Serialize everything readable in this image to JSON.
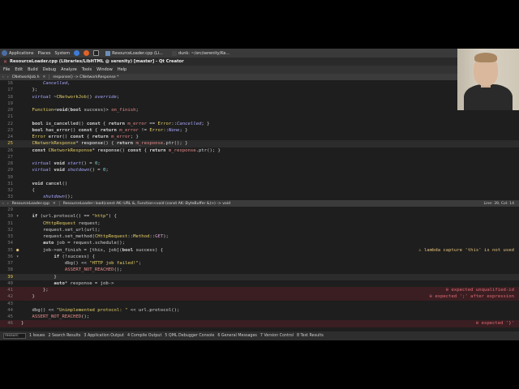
{
  "panel": {
    "applications": "Applications",
    "places": "Places",
    "system": "System",
    "task1": "ResourceLoader.cpp (Li...",
    "task2": "dunk: ~/src/serenity/Ke..."
  },
  "window": {
    "title": "ResourceLoader.cpp (Libraries/LibHTML @ serenity) [master] - Qt Creator"
  },
  "menu": [
    "File",
    "Edit",
    "Build",
    "Debug",
    "Analyze",
    "Tools",
    "Window",
    "Help"
  ],
  "top_editor": {
    "file": "CNetworkJob.h",
    "symbol": "response() -> CNetworkResponse *"
  },
  "top_code": [
    {
      "n": "16",
      "spans": [
        {
          "c": "it",
          "t": "        Cancelled,"
        }
      ]
    },
    {
      "n": "17",
      "spans": [
        {
          "c": "",
          "t": "    };"
        }
      ]
    },
    {
      "n": "18",
      "spans": [
        {
          "c": "it",
          "t": "    virtual"
        },
        {
          "c": "",
          "t": " ~"
        },
        {
          "c": "t",
          "t": "CNetworkJob"
        },
        {
          "c": "",
          "t": "() "
        },
        {
          "c": "it",
          "t": "override"
        },
        {
          "c": "",
          "t": ";"
        }
      ]
    },
    {
      "n": "19",
      "spans": []
    },
    {
      "n": "20",
      "spans": [
        {
          "c": "t",
          "t": "    Function"
        },
        {
          "c": "",
          "t": "<"
        },
        {
          "c": "k",
          "t": "void"
        },
        {
          "c": "",
          "t": "("
        },
        {
          "c": "k",
          "t": "bool"
        },
        {
          "c": "",
          "t": " success)> "
        },
        {
          "c": "v",
          "t": "on_finish"
        },
        {
          "c": "",
          "t": ";"
        }
      ]
    },
    {
      "n": "21",
      "spans": []
    },
    {
      "n": "22",
      "spans": [
        {
          "c": "k",
          "t": "    bool"
        },
        {
          "c": "f",
          "t": " is_cancelled"
        },
        {
          "c": "",
          "t": "() "
        },
        {
          "c": "k",
          "t": "const"
        },
        {
          "c": "",
          "t": " { "
        },
        {
          "c": "k",
          "t": "return"
        },
        {
          "c": "v",
          "t": " m_error"
        },
        {
          "c": "",
          "t": " == "
        },
        {
          "c": "t",
          "t": "Error"
        },
        {
          "c": "",
          "t": "::"
        },
        {
          "c": "it",
          "t": "Cancelled"
        },
        {
          "c": "",
          "t": "; }"
        }
      ]
    },
    {
      "n": "23",
      "spans": [
        {
          "c": "k",
          "t": "    bool"
        },
        {
          "c": "f",
          "t": " has_error"
        },
        {
          "c": "",
          "t": "() "
        },
        {
          "c": "k",
          "t": "const"
        },
        {
          "c": "",
          "t": " { "
        },
        {
          "c": "k",
          "t": "return"
        },
        {
          "c": "v",
          "t": " m_error"
        },
        {
          "c": "",
          "t": " != "
        },
        {
          "c": "t",
          "t": "Error"
        },
        {
          "c": "",
          "t": "::"
        },
        {
          "c": "it",
          "t": "None"
        },
        {
          "c": "",
          "t": "; }"
        }
      ]
    },
    {
      "n": "24",
      "spans": [
        {
          "c": "t",
          "t": "    Error"
        },
        {
          "c": "f",
          "t": " error"
        },
        {
          "c": "",
          "t": "() "
        },
        {
          "c": "k",
          "t": "const"
        },
        {
          "c": "",
          "t": " { "
        },
        {
          "c": "k",
          "t": "return"
        },
        {
          "c": "v",
          "t": " m_error"
        },
        {
          "c": "",
          "t": "; }"
        }
      ]
    },
    {
      "n": "25",
      "cur": true,
      "spans": [
        {
          "c": "t",
          "t": "    CNetworkResponse"
        },
        {
          "c": "",
          "t": "* "
        },
        {
          "c": "f",
          "t": "response"
        },
        {
          "c": "",
          "t": "() { "
        },
        {
          "c": "k",
          "t": "return"
        },
        {
          "c": "v",
          "t": " m_response"
        },
        {
          "c": "",
          "t": ".ptr(); }"
        }
      ]
    },
    {
      "n": "26",
      "spans": [
        {
          "c": "k",
          "t": "    const"
        },
        {
          "c": "t",
          "t": " CNetworkResponse"
        },
        {
          "c": "",
          "t": "* "
        },
        {
          "c": "f",
          "t": "response"
        },
        {
          "c": "",
          "t": "() "
        },
        {
          "c": "k",
          "t": "const"
        },
        {
          "c": "",
          "t": " { "
        },
        {
          "c": "k",
          "t": "return"
        },
        {
          "c": "v",
          "t": " m_response"
        },
        {
          "c": "",
          "t": ".ptr(); }"
        }
      ]
    },
    {
      "n": "27",
      "spans": []
    },
    {
      "n": "28",
      "spans": [
        {
          "c": "it",
          "t": "    virtual"
        },
        {
          "c": "k",
          "t": " void"
        },
        {
          "c": "it",
          "t": " start"
        },
        {
          "c": "",
          "t": "() = "
        },
        {
          "c": "n",
          "t": "0"
        },
        {
          "c": "",
          "t": ";"
        }
      ]
    },
    {
      "n": "29",
      "spans": [
        {
          "c": "it",
          "t": "    virtual"
        },
        {
          "c": "k",
          "t": " void"
        },
        {
          "c": "it",
          "t": " shutdown"
        },
        {
          "c": "",
          "t": "() = "
        },
        {
          "c": "n",
          "t": "0"
        },
        {
          "c": "",
          "t": ";"
        }
      ]
    },
    {
      "n": "30",
      "spans": []
    },
    {
      "n": "31",
      "spans": [
        {
          "c": "k",
          "t": "    void"
        },
        {
          "c": "f",
          "t": " cancel"
        },
        {
          "c": "",
          "t": "()"
        }
      ]
    },
    {
      "n": "32",
      "spans": [
        {
          "c": "",
          "t": "    {"
        }
      ]
    },
    {
      "n": "33",
      "spans": [
        {
          "c": "it",
          "t": "        shutdown"
        },
        {
          "c": "",
          "t": "();"
        }
      ]
    }
  ],
  "bottom_editor": {
    "file": "ResourceLoader.cpp",
    "symbol": "ResourceLoader::load(const AK::URL &, Function<void (const AK::ByteBuffer &)>) -> void",
    "position": "Line: 39, Col: 14"
  },
  "bottom_code": [
    {
      "n": "29",
      "spans": []
    },
    {
      "n": "30",
      "fold": "▾",
      "spans": [
        {
          "c": "k",
          "t": "    if"
        },
        {
          "c": "",
          "t": " (url.protocol() == "
        },
        {
          "c": "s",
          "t": "\"http\""
        },
        {
          "c": "",
          "t": ") {"
        }
      ]
    },
    {
      "n": "31",
      "spans": [
        {
          "c": "t",
          "t": "        CHttpRequest"
        },
        {
          "c": "",
          "t": " request;"
        }
      ]
    },
    {
      "n": "32",
      "spans": [
        {
          "c": "",
          "t": "        request.set_url(url);"
        }
      ]
    },
    {
      "n": "33",
      "spans": [
        {
          "c": "",
          "t": "        request.set_method("
        },
        {
          "c": "t",
          "t": "CHttpRequest"
        },
        {
          "c": "",
          "t": "::"
        },
        {
          "c": "t",
          "t": "Method"
        },
        {
          "c": "",
          "t": "::"
        },
        {
          "c": "mg",
          "t": "GET"
        },
        {
          "c": "",
          "t": ");"
        }
      ]
    },
    {
      "n": "34",
      "spans": [
        {
          "c": "k",
          "t": "        auto"
        },
        {
          "c": "",
          "t": " job = request.schedule();"
        }
      ]
    },
    {
      "n": "35",
      "warn": true,
      "fold": "▾",
      "spans": [
        {
          "c": "",
          "t": "        job->on_finish = [this, job]("
        },
        {
          "c": "k",
          "t": "bool"
        },
        {
          "c": "",
          "t": " success) {"
        }
      ],
      "diag": "⚠ lambda capture 'this' is not used"
    },
    {
      "n": "36",
      "fold": "▾",
      "spans": [
        {
          "c": "k",
          "t": "            if"
        },
        {
          "c": "",
          "t": " (!success) {"
        }
      ]
    },
    {
      "n": "37",
      "spans": [
        {
          "c": "",
          "t": "                dbg() << "
        },
        {
          "c": "s",
          "t": "\"HTTP job failed!\""
        },
        {
          "c": "",
          "t": ";"
        }
      ]
    },
    {
      "n": "38",
      "spans": [
        {
          "c": "v",
          "t": "                ASSERT_NOT_REACHED"
        },
        {
          "c": "",
          "t": "();"
        }
      ]
    },
    {
      "n": "39",
      "cur": true,
      "spans": [
        {
          "c": "",
          "t": "            }"
        }
      ]
    },
    {
      "n": "40",
      "spans": [
        {
          "c": "k",
          "t": "            auto"
        },
        {
          "c": "",
          "t": "* response = job->"
        }
      ]
    },
    {
      "n": "41",
      "error": true,
      "spans": [
        {
          "c": "",
          "t": "        };"
        }
      ],
      "diag": "⊖ expected unqualified-id"
    },
    {
      "n": "42",
      "error": true,
      "spans": [
        {
          "c": "",
          "t": "    }"
        }
      ],
      "diag": "⊖ expected ';' after expression"
    },
    {
      "n": "43",
      "spans": []
    },
    {
      "n": "44",
      "spans": [
        {
          "c": "",
          "t": "    dbg() << "
        },
        {
          "c": "s",
          "t": "\"Unimplemented protocol: \""
        },
        {
          "c": "",
          "t": " << url.protocol();"
        }
      ]
    },
    {
      "n": "45",
      "spans": [
        {
          "c": "v",
          "t": "    ASSERT_NOT_REACHED"
        },
        {
          "c": "",
          "t": "();"
        }
      ]
    },
    {
      "n": "46",
      "error": true,
      "spans": [
        {
          "c": "",
          "t": "}"
        }
      ],
      "diag": "⊖ expected '}'"
    }
  ],
  "output_bar": {
    "search_value": "resourc",
    "tabs": [
      "1 Issues",
      "2 Search Results",
      "3 Application Output",
      "4 Compile Output",
      "5 QML Debugger Console",
      "6 General Messages",
      "7 Version Control",
      "8 Test Results"
    ]
  },
  "colors": {
    "editor_bg": "#1e1e1e",
    "warning": "#e5c07b",
    "error": "#e06c75",
    "keyword": "#d7d7d7",
    "type": "#e6cf67"
  }
}
